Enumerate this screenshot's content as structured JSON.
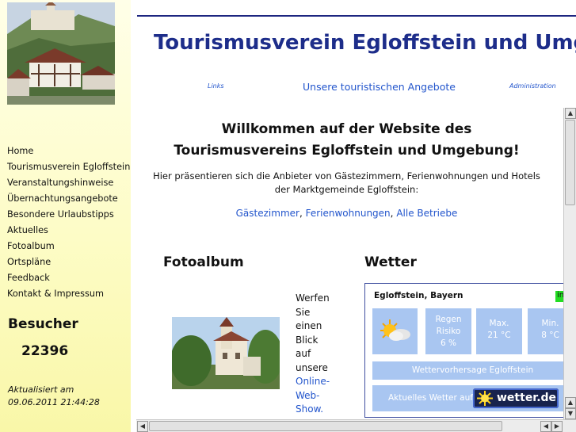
{
  "sidebar": {
    "nav": [
      "Home",
      "Tourismusverein Egloffstein",
      "Veranstaltungshinweise",
      "Übernachtungsangebote",
      "Besondere Urlaubstipps",
      "Aktuelles",
      "Fotoalbum",
      "Ortspläne",
      "Feedback",
      "Kontakt & Impressum"
    ],
    "besucher_label": "Besucher",
    "besucher_count": "22396",
    "updated_label": "Aktualisiert am",
    "updated_date": "09.06.2011 21:44:28"
  },
  "header": {
    "title": "Tourismusverein Egloffstein und Umgebung",
    "link_links": "Links",
    "link_angebote": "Unsere touristischen Angebote",
    "link_admin": "Administration"
  },
  "welcome": {
    "line1": "Willkommen auf der Website des",
    "line2": "Tourismusvereins Egloffstein und Umgebung!",
    "intro1": "Hier präsentieren sich die Anbieter von Gästezimmern, Ferienwohnungen und Hotels",
    "intro2": "der Marktgemeinde Egloffstein:",
    "link_gaeste": "Gästezimmer",
    "link_ferien": "Ferienwohnungen",
    "link_alle": "Alle Betriebe",
    "sep": ", "
  },
  "fotoalbum": {
    "title": "Fotoalbum",
    "text_words": [
      "Werfen",
      "Sie",
      "einen",
      "Blick",
      "auf",
      "unsere"
    ],
    "link_words": [
      "Online-",
      "Web-",
      "Show."
    ]
  },
  "wetter": {
    "title": "Wetter",
    "location": "Egloffstein, Bayern",
    "badge": "in",
    "rain_label1": "Regen",
    "rain_label2": "Risiko",
    "rain_value": "6 %",
    "max_label": "Max.",
    "max_value": "21 °C",
    "min_label": "Min.",
    "min_value": "8 °C",
    "forecast_link": "Wettervorhersage Egloffstein",
    "current_label": "Aktuelles Wetter auf",
    "logo_text": "wetter.de"
  },
  "colors": {
    "title_blue": "#1d2d8a",
    "link_blue": "#2255cc",
    "weather_tile": "#a9c6f1",
    "sidebar_bg": "#fdfcc6"
  },
  "icons": [
    "sun-cloud-icon",
    "scroll-up-icon",
    "scroll-down-icon",
    "scroll-left-icon",
    "scroll-right-icon"
  ]
}
